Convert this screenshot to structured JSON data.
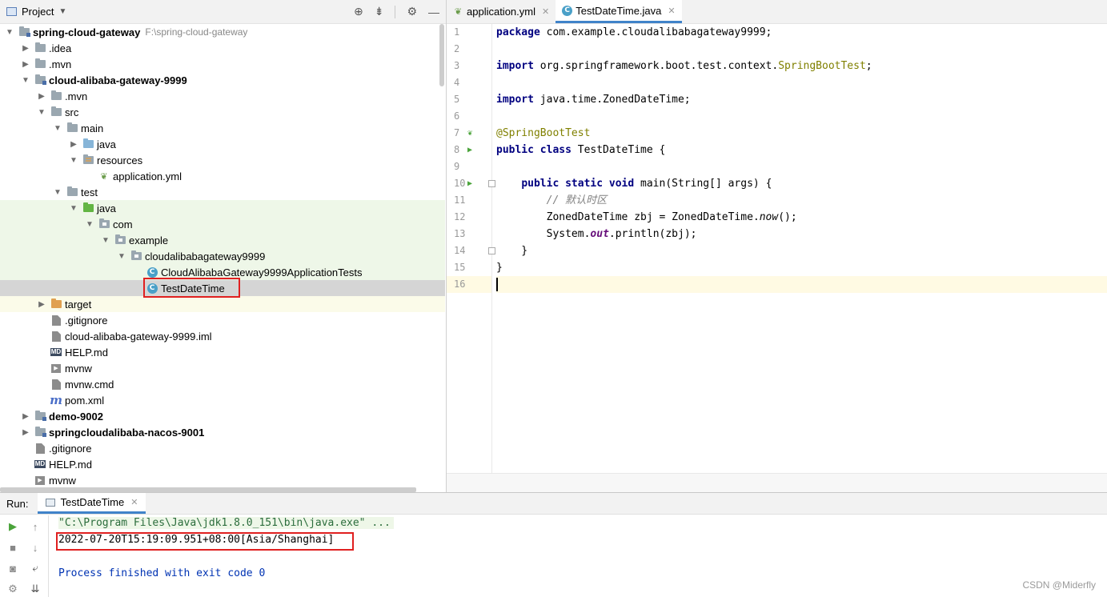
{
  "project_panel": {
    "title": "Project",
    "tree": [
      {
        "label": "spring-cloud-gateway",
        "path": "F:\\spring-cloud-gateway",
        "depth": 0,
        "expanded": true,
        "icon": "module-folder",
        "bold": true
      },
      {
        "label": ".idea",
        "depth": 1,
        "expanded": false,
        "icon": "folder"
      },
      {
        "label": ".mvn",
        "depth": 1,
        "expanded": false,
        "icon": "folder"
      },
      {
        "label": "cloud-alibaba-gateway-9999",
        "depth": 1,
        "expanded": true,
        "icon": "module-folder",
        "bold": true
      },
      {
        "label": ".mvn",
        "depth": 2,
        "expanded": false,
        "icon": "folder"
      },
      {
        "label": "src",
        "depth": 2,
        "expanded": true,
        "icon": "folder"
      },
      {
        "label": "main",
        "depth": 3,
        "expanded": true,
        "icon": "folder"
      },
      {
        "label": "java",
        "depth": 4,
        "expanded": false,
        "icon": "source-folder"
      },
      {
        "label": "resources",
        "depth": 4,
        "expanded": true,
        "icon": "resources-folder"
      },
      {
        "label": "application.yml",
        "depth": 5,
        "icon": "spring-yml"
      },
      {
        "label": "test",
        "depth": 3,
        "expanded": true,
        "icon": "folder"
      },
      {
        "label": "java",
        "depth": 4,
        "expanded": true,
        "icon": "test-folder",
        "bg": "test"
      },
      {
        "label": "com",
        "depth": 5,
        "expanded": true,
        "icon": "package",
        "bg": "test"
      },
      {
        "label": "example",
        "depth": 6,
        "expanded": true,
        "icon": "package",
        "bg": "test"
      },
      {
        "label": "cloudalibabagateway9999",
        "depth": 7,
        "expanded": true,
        "icon": "package",
        "bg": "test"
      },
      {
        "label": "CloudAlibabaGateway9999ApplicationTests",
        "depth": 8,
        "icon": "class",
        "bg": "test"
      },
      {
        "label": "TestDateTime",
        "depth": 8,
        "icon": "class",
        "bg": "selected"
      },
      {
        "label": "target",
        "depth": 2,
        "expanded": false,
        "icon": "excluded-folder",
        "bg": "excluded"
      },
      {
        "label": ".gitignore",
        "depth": 2,
        "icon": "file"
      },
      {
        "label": "cloud-alibaba-gateway-9999.iml",
        "depth": 2,
        "icon": "file"
      },
      {
        "label": "HELP.md",
        "depth": 2,
        "icon": "markdown"
      },
      {
        "label": "mvnw",
        "depth": 2,
        "icon": "terminal-file"
      },
      {
        "label": "mvnw.cmd",
        "depth": 2,
        "icon": "file"
      },
      {
        "label": "pom.xml",
        "depth": 2,
        "icon": "maven"
      },
      {
        "label": "demo-9002",
        "depth": 1,
        "expanded": false,
        "icon": "module-folder",
        "bold": true
      },
      {
        "label": "springcloudalibaba-nacos-9001",
        "depth": 1,
        "expanded": false,
        "icon": "module-folder",
        "bold": true
      },
      {
        "label": ".gitignore",
        "depth": 1,
        "icon": "file"
      },
      {
        "label": "HELP.md",
        "depth": 1,
        "icon": "markdown"
      },
      {
        "label": "mvnw",
        "depth": 1,
        "icon": "terminal-file"
      }
    ]
  },
  "editor": {
    "tabs": [
      {
        "label": "application.yml",
        "icon": "spring-yml",
        "active": false
      },
      {
        "label": "TestDateTime.java",
        "icon": "class",
        "active": true
      }
    ],
    "line_numbers": [
      "1",
      "2",
      "3",
      "4",
      "5",
      "6",
      "7",
      "8",
      "9",
      "10",
      "11",
      "12",
      "13",
      "14",
      "15",
      "16"
    ],
    "code": {
      "l1_kw": "package",
      "l1_rest": " com.example.cloudalibabagateway9999;",
      "l3_kw": "import",
      "l3_rest": " org.springframework.boot.test.context.",
      "l3_ann": "SpringBootTest",
      "l3_end": ";",
      "l5_kw": "import",
      "l5_rest": " java.time.ZonedDateTime;",
      "l7_ann": "@SpringBootTest",
      "l8_kw": "public class",
      "l8_rest": " TestDateTime {",
      "l10_indent": "    ",
      "l10_kw": "public static void",
      "l10_rest": " main(String[] args) {",
      "l11_indent": "        ",
      "l11_cmt": "// 默认时区",
      "l12_indent": "        ",
      "l12_pre": "ZonedDateTime zbj = ZonedDateTime.",
      "l12_ital": "now",
      "l12_end": "();",
      "l13_indent": "        ",
      "l13_pre": "System.",
      "l13_static": "out",
      "l13_end": ".println(zbj);",
      "l14_text": "    }",
      "l15_text": "}"
    }
  },
  "run_panel": {
    "label": "Run:",
    "tab": "TestDateTime",
    "console": {
      "command": "\"C:\\Program Files\\Java\\jdk1.8.0_151\\bin\\java.exe\" ...",
      "output": "2022-07-20T15:19:09.951+08:00[Asia/Shanghai]",
      "exit": "Process finished with exit code 0"
    }
  },
  "watermark": "CSDN @Miderfly",
  "colors": {
    "accent": "#4083c9",
    "highlight_box": "#e02020",
    "keyword": "#000080",
    "annotation": "#808000",
    "test_bg": "#eef7e8"
  }
}
